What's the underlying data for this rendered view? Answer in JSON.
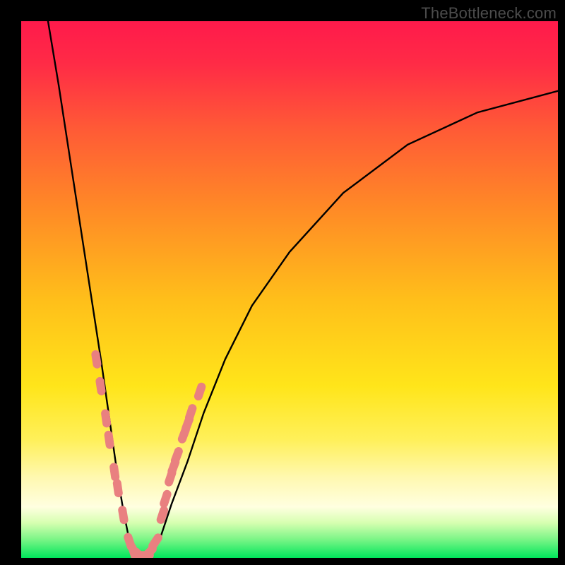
{
  "watermark": "TheBottleneck.com",
  "colors": {
    "frame": "#000000",
    "curve": "#000000",
    "marker_fill": "#e98080",
    "green": "#00e65b",
    "gradient_stops": [
      {
        "offset": 0.0,
        "color": "#ff1a4b"
      },
      {
        "offset": 0.08,
        "color": "#ff2b46"
      },
      {
        "offset": 0.2,
        "color": "#ff5a36"
      },
      {
        "offset": 0.35,
        "color": "#ff8a26"
      },
      {
        "offset": 0.52,
        "color": "#ffbf1a"
      },
      {
        "offset": 0.68,
        "color": "#ffe51a"
      },
      {
        "offset": 0.78,
        "color": "#fff05a"
      },
      {
        "offset": 0.85,
        "color": "#fff8b0"
      },
      {
        "offset": 0.905,
        "color": "#ffffe0"
      },
      {
        "offset": 0.935,
        "color": "#d6ffb0"
      },
      {
        "offset": 0.965,
        "color": "#7cf587"
      },
      {
        "offset": 1.0,
        "color": "#00e65b"
      }
    ]
  },
  "chart_data": {
    "type": "line",
    "title": "",
    "xlabel": "",
    "ylabel": "",
    "xlim": [
      0,
      100
    ],
    "ylim": [
      0,
      100
    ],
    "note": "Axes are unlabeled; x roughly represents a component ratio and y the bottleneck severity (0 = no bottleneck, top = maximum). Values estimated from pixel positions.",
    "series": [
      {
        "name": "bottleneck-curve",
        "x": [
          5,
          7,
          9,
          11,
          13,
          15,
          16,
          17,
          18,
          19,
          20,
          21,
          22,
          23,
          24,
          26,
          28,
          31,
          34,
          38,
          43,
          50,
          60,
          72,
          85,
          100
        ],
        "y": [
          100,
          88,
          75,
          62,
          49,
          36,
          29,
          22,
          15,
          9,
          4,
          1,
          0,
          0,
          1,
          4,
          10,
          18,
          27,
          37,
          47,
          57,
          68,
          77,
          83,
          87
        ]
      }
    ],
    "markers": {
      "name": "highlighted-segments",
      "shape": "rounded-pill",
      "color": "#e98080",
      "points_xy": [
        [
          14.0,
          37
        ],
        [
          14.8,
          32
        ],
        [
          15.8,
          26
        ],
        [
          16.4,
          22
        ],
        [
          17.4,
          16
        ],
        [
          18.0,
          13
        ],
        [
          19.0,
          8
        ],
        [
          20.2,
          3
        ],
        [
          21.0,
          1
        ],
        [
          22.0,
          0.5
        ],
        [
          23.0,
          0.5
        ],
        [
          23.8,
          1
        ],
        [
          25.0,
          3
        ],
        [
          26.3,
          8
        ],
        [
          26.9,
          11
        ],
        [
          27.8,
          15
        ],
        [
          28.4,
          17
        ],
        [
          29.0,
          19
        ],
        [
          30.3,
          23
        ],
        [
          31.0,
          25
        ],
        [
          31.6,
          27
        ],
        [
          33.3,
          31
        ]
      ]
    }
  }
}
